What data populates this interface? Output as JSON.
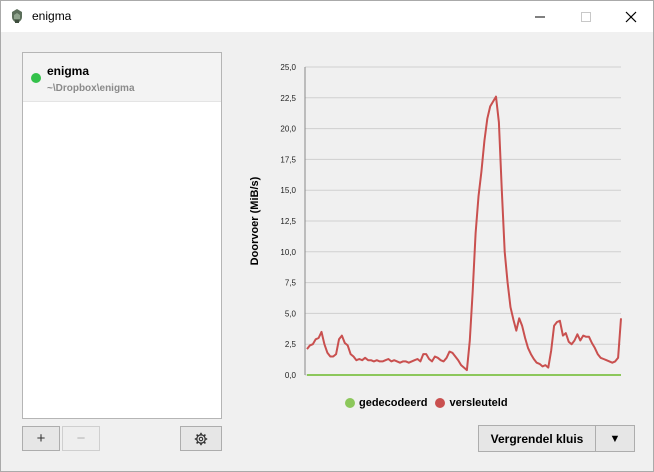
{
  "window": {
    "title": "enigma"
  },
  "vaults": [
    {
      "name": "enigma",
      "path": "~\\Dropbox\\enigma",
      "status": "unlocked",
      "status_color": "#33c14a"
    }
  ],
  "buttons": {
    "add": "+",
    "remove": "−",
    "settings_icon": "gear-icon",
    "lock": "Vergrendel kluis",
    "dropdown": "▼"
  },
  "chart_data": {
    "type": "line",
    "ylabel": "Doorvoer (MiB/s)",
    "ylim": [
      0,
      25
    ],
    "yticks": [
      "0,0",
      "2,5",
      "5,0",
      "7,5",
      "10,0",
      "12,5",
      "15,0",
      "17,5",
      "20,0",
      "22,5",
      "25,0"
    ],
    "grid": true,
    "legend_position": "bottom",
    "series": [
      {
        "name": "gedecodeerd",
        "color": "#8cc75b",
        "values": [
          0,
          0,
          0,
          0,
          0,
          0,
          0,
          0,
          0,
          0,
          0,
          0,
          0,
          0,
          0,
          0,
          0,
          0,
          0,
          0,
          0,
          0,
          0,
          0,
          0,
          0,
          0,
          0,
          0,
          0,
          0,
          0,
          0,
          0,
          0,
          0,
          0,
          0,
          0,
          0,
          0,
          0,
          0,
          0,
          0,
          0,
          0,
          0,
          0,
          0,
          0,
          0,
          0,
          0,
          0,
          0,
          0,
          0,
          0,
          0,
          0,
          0,
          0,
          0,
          0,
          0,
          0,
          0,
          0,
          0,
          0,
          0,
          0,
          0,
          0,
          0,
          0,
          0,
          0,
          0,
          0,
          0,
          0,
          0,
          0,
          0,
          0,
          0,
          0,
          0,
          0,
          0,
          0,
          0,
          0,
          0,
          0,
          0,
          0,
          0,
          0,
          0,
          0,
          0,
          0,
          0,
          0,
          0,
          0,
          0,
          0,
          0,
          0,
          0,
          0,
          0,
          0,
          0,
          0,
          0,
          0,
          0,
          0,
          0,
          0,
          0,
          0,
          0,
          0,
          0,
          0,
          0,
          0,
          0,
          0,
          0,
          0,
          0,
          0,
          0,
          0,
          0,
          0,
          0,
          0,
          0,
          0,
          0,
          0,
          0,
          0,
          0
        ]
      },
      {
        "name": "versleuteld",
        "color": "#c9504f",
        "values": [
          2.1,
          2.4,
          2.5,
          2.9,
          3.0,
          3.5,
          2.5,
          1.8,
          1.5,
          1.5,
          1.7,
          2.9,
          3.2,
          2.6,
          2.4,
          1.7,
          1.5,
          1.2,
          1.3,
          1.2,
          1.4,
          1.2,
          1.2,
          1.1,
          1.2,
          1.1,
          1.1,
          1.2,
          1.3,
          1.1,
          1.2,
          1.1,
          1.0,
          1.1,
          1.1,
          1.0,
          1.1,
          1.2,
          1.3,
          1.1,
          1.7,
          1.7,
          1.3,
          1.1,
          1.5,
          1.4,
          1.2,
          1.1,
          1.4,
          1.9,
          1.8,
          1.5,
          1.2,
          0.8,
          0.6,
          0.4,
          2.8,
          6.8,
          11.5,
          14.5,
          16.5,
          19.0,
          20.8,
          21.8,
          22.2,
          22.6,
          20.5,
          15.0,
          10.0,
          7.5,
          5.5,
          4.5,
          3.6,
          4.6,
          4.0,
          3.0,
          2.2,
          1.7,
          1.3,
          1.0,
          0.9,
          0.7,
          0.8,
          0.6,
          2.0,
          4.0,
          4.3,
          4.4,
          3.2,
          3.4,
          2.7,
          2.5,
          2.8,
          3.3,
          2.8,
          3.2,
          3.1,
          3.1,
          2.6,
          2.2,
          1.7,
          1.4,
          1.3,
          1.2,
          1.1,
          1.0,
          1.1,
          1.4,
          4.6
        ]
      }
    ]
  }
}
